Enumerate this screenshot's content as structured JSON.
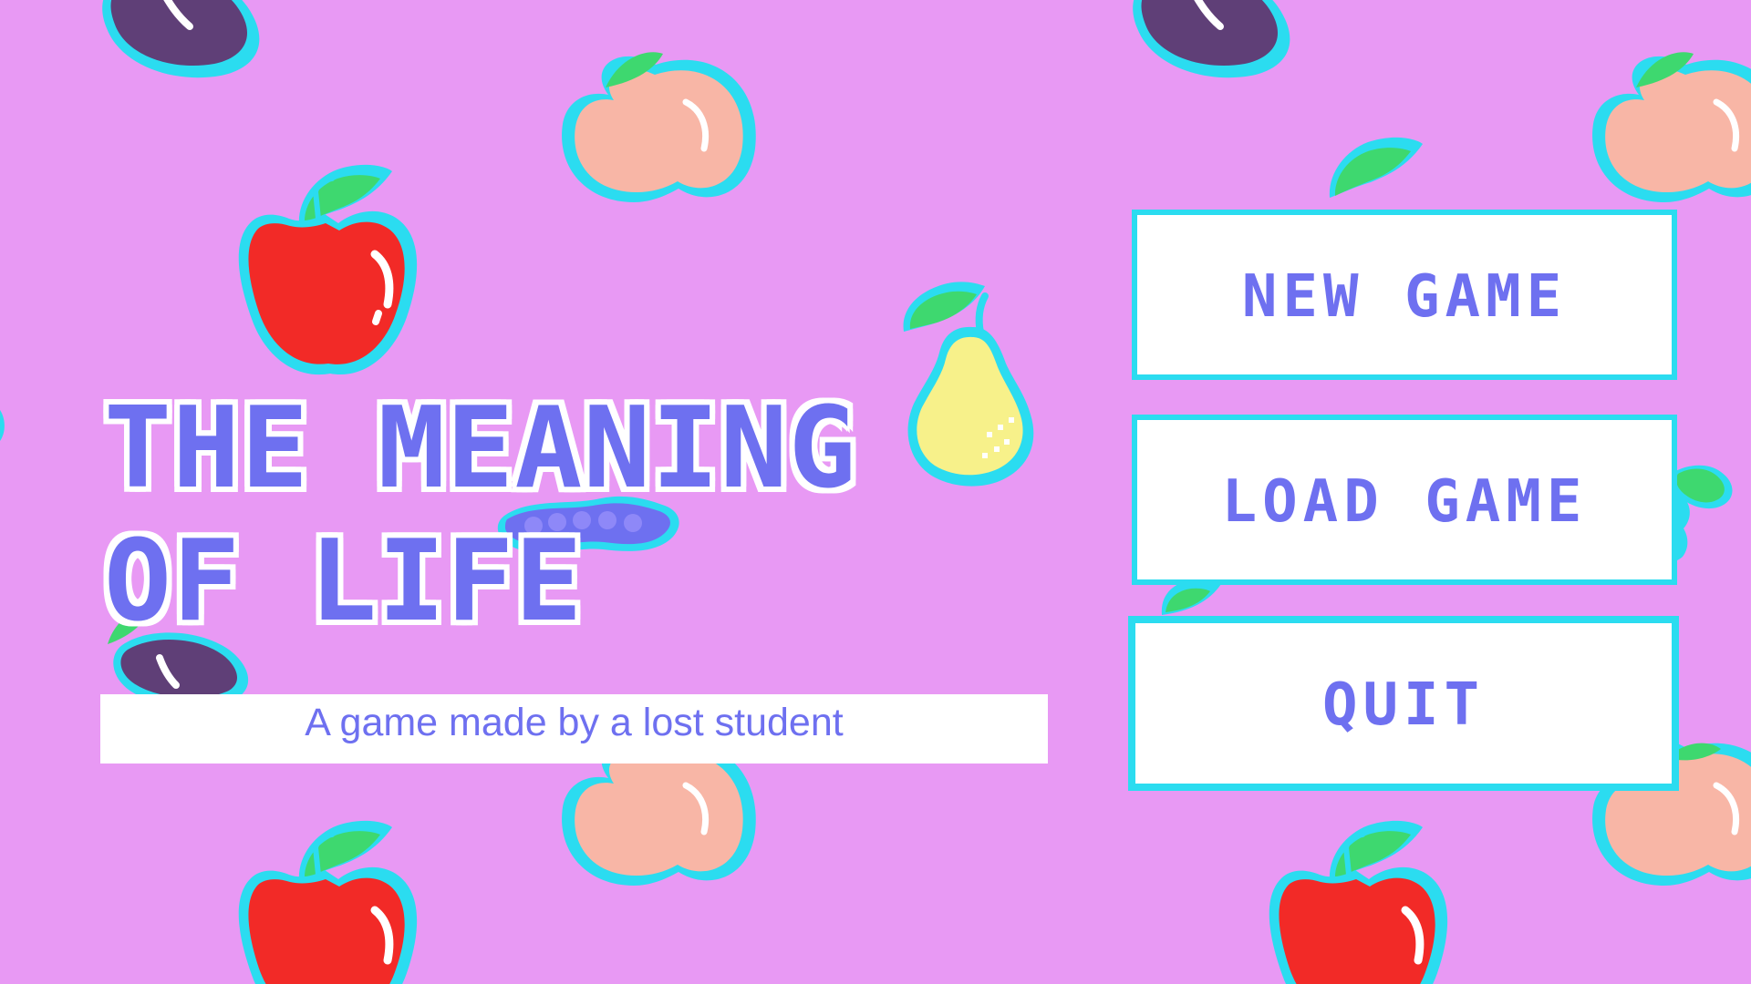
{
  "title": {
    "line1": "THE MEANING",
    "line2": "OF LIFE"
  },
  "subtitle": "A game made by a lost student",
  "menu": {
    "new_game_label": "NEW GAME",
    "load_game_label": "LOAD GAME",
    "quit_label": "QUIT"
  },
  "colors": {
    "background": "#e899f4",
    "accent": "#6e70f0",
    "button_border": "#2bdcf0",
    "button_fill": "#ffffff",
    "apple": "#f22a27",
    "peach": "#f8b6a6",
    "pear": "#f7f18a",
    "plum": "#5f3f77",
    "leaf": "#3ed86f",
    "outline": "#2bdcf0"
  },
  "icons": {
    "background": [
      "apple-icon",
      "peach-icon",
      "pear-icon",
      "plum-icon",
      "grape-icon"
    ]
  }
}
